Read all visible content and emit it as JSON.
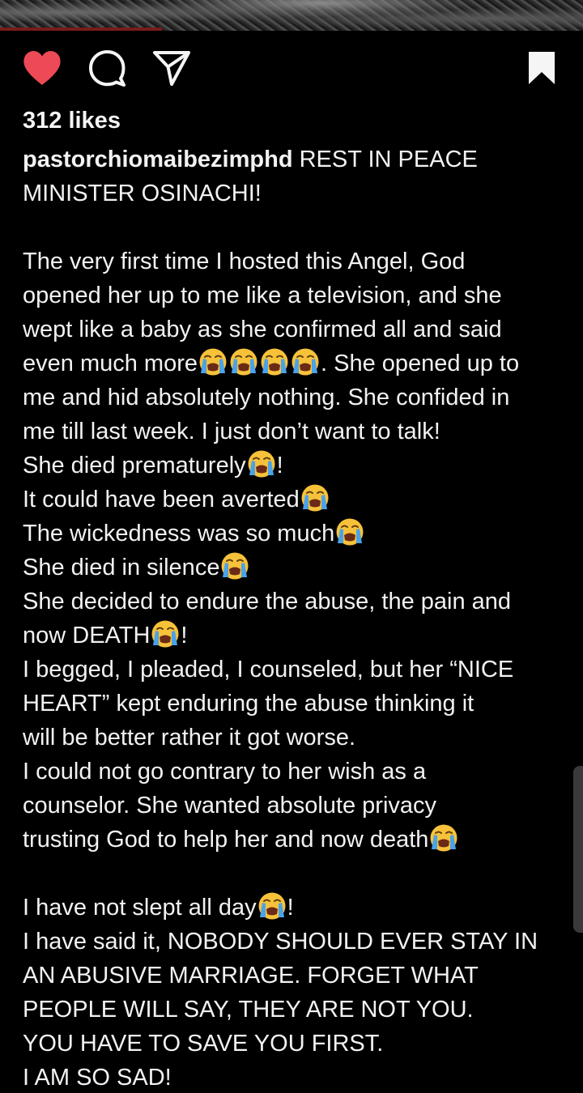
{
  "post": {
    "likes_text": "312 likes",
    "username": "pastorchiomaibezimphd",
    "icons": {
      "like": "heart-icon",
      "comment": "comment-bubble-icon",
      "share": "paper-plane-icon",
      "save": "bookmark-icon",
      "emoji": "loudly-crying-face-emoji"
    },
    "colors": {
      "background": "#000000",
      "text": "#f2f2f2",
      "like_active": "#ed4956",
      "emoji_face": "#f7c23a",
      "emoji_tears": "#4aa3e8"
    }
  },
  "caption_lines": [
    {
      "segs": [
        {
          "t": "REST IN PEACE"
        }
      ]
    },
    {
      "segs": [
        {
          "t": "MINISTER OSINACHI!"
        }
      ]
    },
    {
      "blank": true
    },
    {
      "segs": [
        {
          "t": "The very first time I hosted this Angel, God"
        }
      ]
    },
    {
      "segs": [
        {
          "t": "opened her up to me like a television, and she"
        }
      ]
    },
    {
      "segs": [
        {
          "t": "wept like a baby as she confirmed all and said"
        }
      ]
    },
    {
      "segs": [
        {
          "t": "even much more"
        },
        {
          "e": 4
        },
        {
          "t": ". She opened up to"
        }
      ]
    },
    {
      "segs": [
        {
          "t": "me and hid absolutely nothing. She confided in"
        }
      ]
    },
    {
      "segs": [
        {
          "t": "me till last week. I just don’t want to talk!"
        }
      ]
    },
    {
      "segs": [
        {
          "t": "She died prematurely"
        },
        {
          "e": 1
        },
        {
          "t": "!"
        }
      ]
    },
    {
      "segs": [
        {
          "t": "It could have been averted"
        },
        {
          "e": 1
        }
      ]
    },
    {
      "segs": [
        {
          "t": "The wickedness was so much"
        },
        {
          "e": 1
        }
      ]
    },
    {
      "segs": [
        {
          "t": "She died in silence"
        },
        {
          "e": 1
        }
      ]
    },
    {
      "segs": [
        {
          "t": "She decided to endure the abuse, the pain and"
        }
      ]
    },
    {
      "segs": [
        {
          "t": "now DEATH"
        },
        {
          "e": 1
        },
        {
          "t": "!"
        }
      ]
    },
    {
      "segs": [
        {
          "t": "I begged, I pleaded, I counseled, but her “NICE"
        }
      ]
    },
    {
      "segs": [
        {
          "t": "HEART” kept enduring the abuse thinking it"
        }
      ]
    },
    {
      "segs": [
        {
          "t": "will be better rather it got worse."
        }
      ]
    },
    {
      "segs": [
        {
          "t": "I could not go contrary to her wish as a"
        }
      ]
    },
    {
      "segs": [
        {
          "t": "counselor. She wanted absolute privacy"
        }
      ]
    },
    {
      "segs": [
        {
          "t": "trusting God to help her and now death"
        },
        {
          "e": 1
        }
      ]
    },
    {
      "blank": true
    },
    {
      "segs": [
        {
          "t": "I have not slept all day"
        },
        {
          "e": 1
        },
        {
          "t": "!"
        }
      ]
    },
    {
      "segs": [
        {
          "t": "I have said it, NOBODY SHOULD EVER STAY IN"
        }
      ]
    },
    {
      "segs": [
        {
          "t": "AN ABUSIVE MARRIAGE. FORGET WHAT"
        }
      ]
    },
    {
      "segs": [
        {
          "t": "PEOPLE WILL SAY, THEY ARE NOT YOU."
        }
      ]
    },
    {
      "segs": [
        {
          "t": "YOU HAVE TO SAVE YOU FIRST."
        }
      ]
    },
    {
      "segs": [
        {
          "t": "I AM SO SAD!"
        }
      ]
    }
  ]
}
